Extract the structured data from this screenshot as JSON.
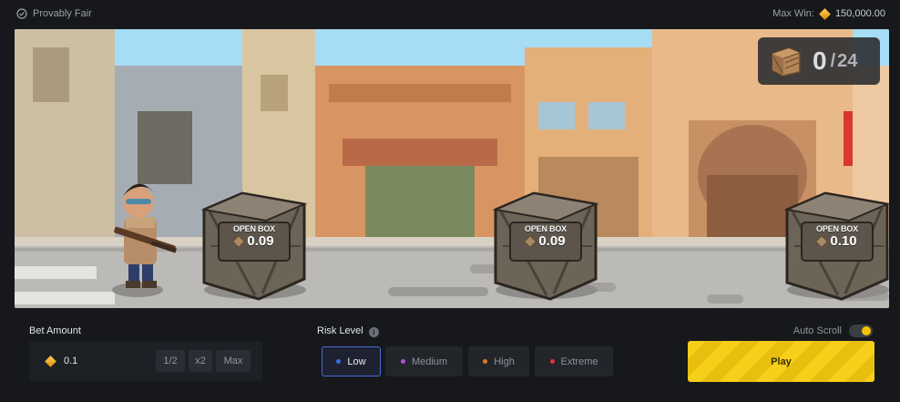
{
  "header": {
    "provably_fair": "Provably Fair",
    "max_win_label": "Max Win:",
    "max_win_value": "150,000.00"
  },
  "counter": {
    "opened": "0",
    "separator": "/",
    "total": "24"
  },
  "boxes": [
    {
      "label": "OPEN BOX",
      "value": "0.09"
    },
    {
      "label": "OPEN BOX",
      "value": "0.09"
    },
    {
      "label": "OPEN BOX",
      "value": "0.10"
    }
  ],
  "controls": {
    "bet_amount_label": "Bet Amount",
    "bet_amount_value": "0.1",
    "half_label": "1/2",
    "double_label": "x2",
    "max_label": "Max",
    "risk_level_label": "Risk Level",
    "risk_options": [
      {
        "label": "Low",
        "color": "#3f6de0",
        "selected": true
      },
      {
        "label": "Medium",
        "color": "#b04ad8",
        "selected": false
      },
      {
        "label": "High",
        "color": "#e07a1a",
        "selected": false
      },
      {
        "label": "Extreme",
        "color": "#d83a3a",
        "selected": false
      }
    ],
    "auto_scroll_label": "Auto Scroll",
    "auto_scroll_on": true,
    "play_label": "Play"
  },
  "colors": {
    "accent": "#f5cf1a",
    "coin": "#f2a91c"
  }
}
